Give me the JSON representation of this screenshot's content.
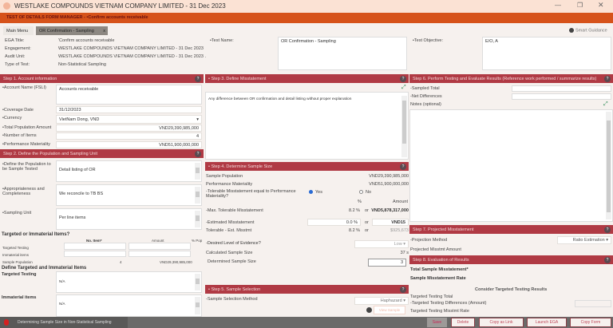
{
  "window": {
    "title": "WESTLAKE COMPOUNDS VIETNAM COMPANY LIMITED - 31 Dec 2023",
    "subtitle": "TEST OF DETAILS FORM MANAGER - •Confirm accounts receivable"
  },
  "tabs": [
    {
      "label": "Main Menu"
    },
    {
      "label": "OR Confirmation - Sampling"
    }
  ],
  "smart_guidance": "Smart Guidance",
  "info": {
    "ega_title_label": "EGA Title:",
    "ega_title": "'Confirm accounts receivable",
    "engagement_label": "Engagement:",
    "engagement": "WESTLAKE COMPOUNDS VIETNAM COMPANY LIMITED - 31 Dec 2023",
    "audit_unit_label": "Audit Unit:",
    "audit_unit": "WESTLAKE COMPOUNDS VIETNAM COMPANY LIMITED - 31 Dec 2023 .",
    "type_label": "Type of Test:",
    "type": "Non-Statistical Sampling",
    "test_name_label": "•Test Name:",
    "test_name": "OR Confirmation - Sampling",
    "test_objective_label": "•Test Objective:",
    "test_objective": "E/O, A"
  },
  "step1": {
    "title": "Step 1. Account information",
    "account_name_label": "•Account Name (FSLI)",
    "account_name": "Accounts receivable",
    "coverage_label": "•Coverage Date",
    "coverage": "31/12/2023",
    "currency_label": "•Currency",
    "currency": "VietNam Dong, VND",
    "total_pop_label": "•Total Population Amount",
    "total_pop": "VND29,390,985,000",
    "items_label": "•Number of Items",
    "items": "4",
    "pm_label": "•Performance Materiality",
    "pm": "VND51,900,000,000"
  },
  "step2": {
    "title": "Step 2. Define the Population and Sampling Unit",
    "define_label": "•Define the Population to be Sample Tested",
    "define": "Detail listing of OR",
    "approp_label": "•Appropriateness and Completeness",
    "approp": "We reconcile to TB  BS",
    "unit_label": "•Sampling Unit",
    "unit": "Per line items",
    "targeted_q": "Targeted or Immaterial Items?",
    "col_items": "No. Item*",
    "col_amount": "Amount",
    "col_pop": "% Pop",
    "row_targeted": "Targeted Testing",
    "row_immaterial": "Immaterial items",
    "row_sample": "Sample Population",
    "sample_items": "4",
    "sample_amount": "VND29,390,985,000",
    "define_ti": "Define Targeted and Immaterial Items",
    "targeted_label": "Targeted Testing",
    "targeted": "N/A",
    "immaterial_label": "Immaterial items",
    "immaterial": "N/A"
  },
  "step3": {
    "title": "• Step 3. Define Misstatement",
    "text": "Any difference between OR confirmation and detail listing without proper explanation"
  },
  "step4": {
    "title": "• Step 4. Determine Sample Size",
    "sample_pop_label": "Sample Population",
    "sample_pop": "VND29,390,985,000",
    "pm_label": "Performance Materiality",
    "pm": "VND51,900,000,000",
    "tol_q": "-Tolerable Misstatement equal to Performance Materiality?",
    "yes": "Yes",
    "no": "No",
    "pct_h": "%",
    "amt_h": "Amount",
    "max_label": "-Max. Tolerable Misstatement",
    "max_pct": "8.2 %",
    "or": "or",
    "max_amt": "VND5,878,317,000",
    "est_label": "-Estimated Misstatement",
    "est_pct": "0.0 %",
    "est_amt": "VND15",
    "tol_est_label": "Tolerable - Est. Misstmt",
    "tol_est_pct": "8.2 %",
    "tol_est_amt": "$925,673",
    "evidence_label": "-Desired Level of Evidence?",
    "evidence": "Low",
    "calc_label": "Calculated Sample Size",
    "calc": "37 s",
    "det_label": "Determined Sample Size",
    "det": "3"
  },
  "step5": {
    "title": "• Step 5. Sample Selection",
    "method_label": "-Sample Selection Method",
    "method": "Haphazard",
    "view": "View Sample"
  },
  "step6": {
    "title": "Step 6. Perform Testing and Evaluate Results (Reference work performed / summarize results)",
    "sampled_label": "-Sampled Total",
    "net_label": "-Net Differences",
    "notes_label": "Notes (optional)"
  },
  "step7": {
    "title": "Step 7. Projected Misstatement",
    "method_label": "-Projection Method",
    "method": "Ratio Estimation",
    "amount_label": "Projected Misstmt Amount"
  },
  "step8": {
    "title": "Step 8. Evaluation of Results",
    "total_label": "Total Sample Misstatement*",
    "rate_label": "Sample Misstatement Rate",
    "consider": "Consider Targeted Testing Results",
    "tt_total": "Targeted Testing Total",
    "tt_diff": "-Targeted Testing Differences (Amount)",
    "tt_rate": "Targeted Testing Misstmt Rate"
  },
  "footer": {
    "notice": "Determining Sample Size in Non-Statistical Sampling",
    "save": "Save",
    "delete": "Delete",
    "copy_link": "Copy as Link",
    "launch": "Launch EGA",
    "copy_form": "Copy Form"
  }
}
